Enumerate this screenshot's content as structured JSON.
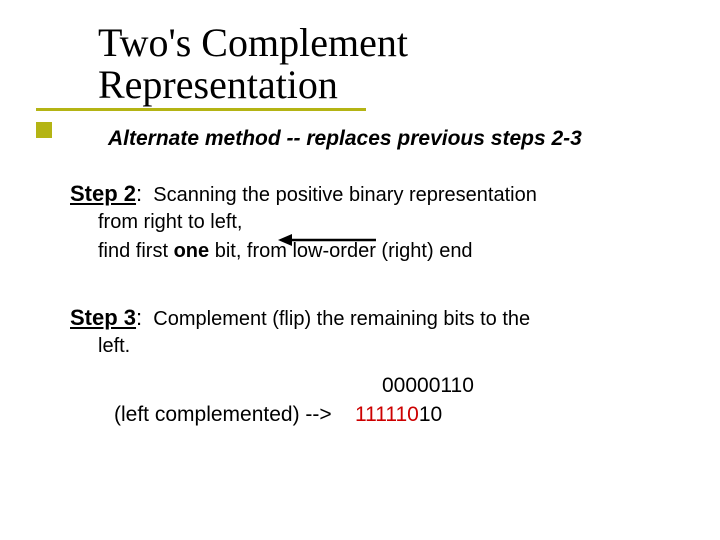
{
  "title": {
    "line1": "Two's Complement",
    "line2": "Representation"
  },
  "alternate_method": "Alternate method -- replaces previous steps 2-3",
  "step2": {
    "label": "Step 2",
    "colon": ":",
    "text_a": "Scanning the positive binary representation",
    "text_b": "from right to left,",
    "text_c_pre": "find first ",
    "text_c_bold": "one",
    "text_c_post": " bit, from low-order (right) end"
  },
  "step3": {
    "label": "Step 3",
    "colon": ":",
    "text_a": "Complement (flip) the remaining bits to the",
    "text_b": "left."
  },
  "binary": {
    "original": "00000110",
    "left_label": "(left complemented) -->",
    "result_red": "111110",
    "result_rest": "10"
  }
}
